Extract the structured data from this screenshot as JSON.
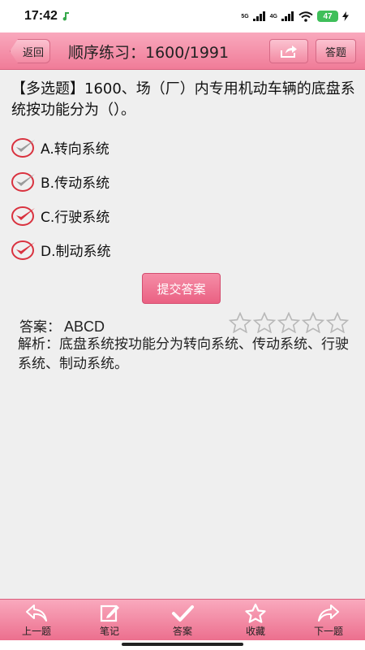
{
  "status_bar": {
    "time": "17:42",
    "net1": "5G",
    "net2": "4G",
    "battery": "47"
  },
  "header": {
    "back_label": "返回",
    "title": "顺序练习：1600/1991",
    "answer_sheet_label": "答题"
  },
  "question": {
    "text": "【多选题】1600、场（厂）内专用机动车辆的底盘系统按功能分为（）。"
  },
  "options": [
    {
      "label": "A.转向系统",
      "selected": false
    },
    {
      "label": "B.传动系统",
      "selected": false
    },
    {
      "label": "C.行驶系统",
      "selected": true
    },
    {
      "label": "D.制动系统",
      "selected": true
    }
  ],
  "submit_label": "提交答案",
  "answer": {
    "label": "答案：",
    "value": "ABCD"
  },
  "rating": {
    "stars": 5,
    "filled": 0
  },
  "explanation": {
    "text": "解析：底盘系统按功能分为转向系统、传动系统、行驶系统、制动系统。"
  },
  "bottom_nav": {
    "prev": "上一题",
    "notes": "笔记",
    "answer": "答案",
    "favorite": "收藏",
    "next": "下一题"
  },
  "colors": {
    "accent": "#f07c98",
    "check_selected": "#d9323f",
    "check_unselected": "#9a9a9a"
  }
}
